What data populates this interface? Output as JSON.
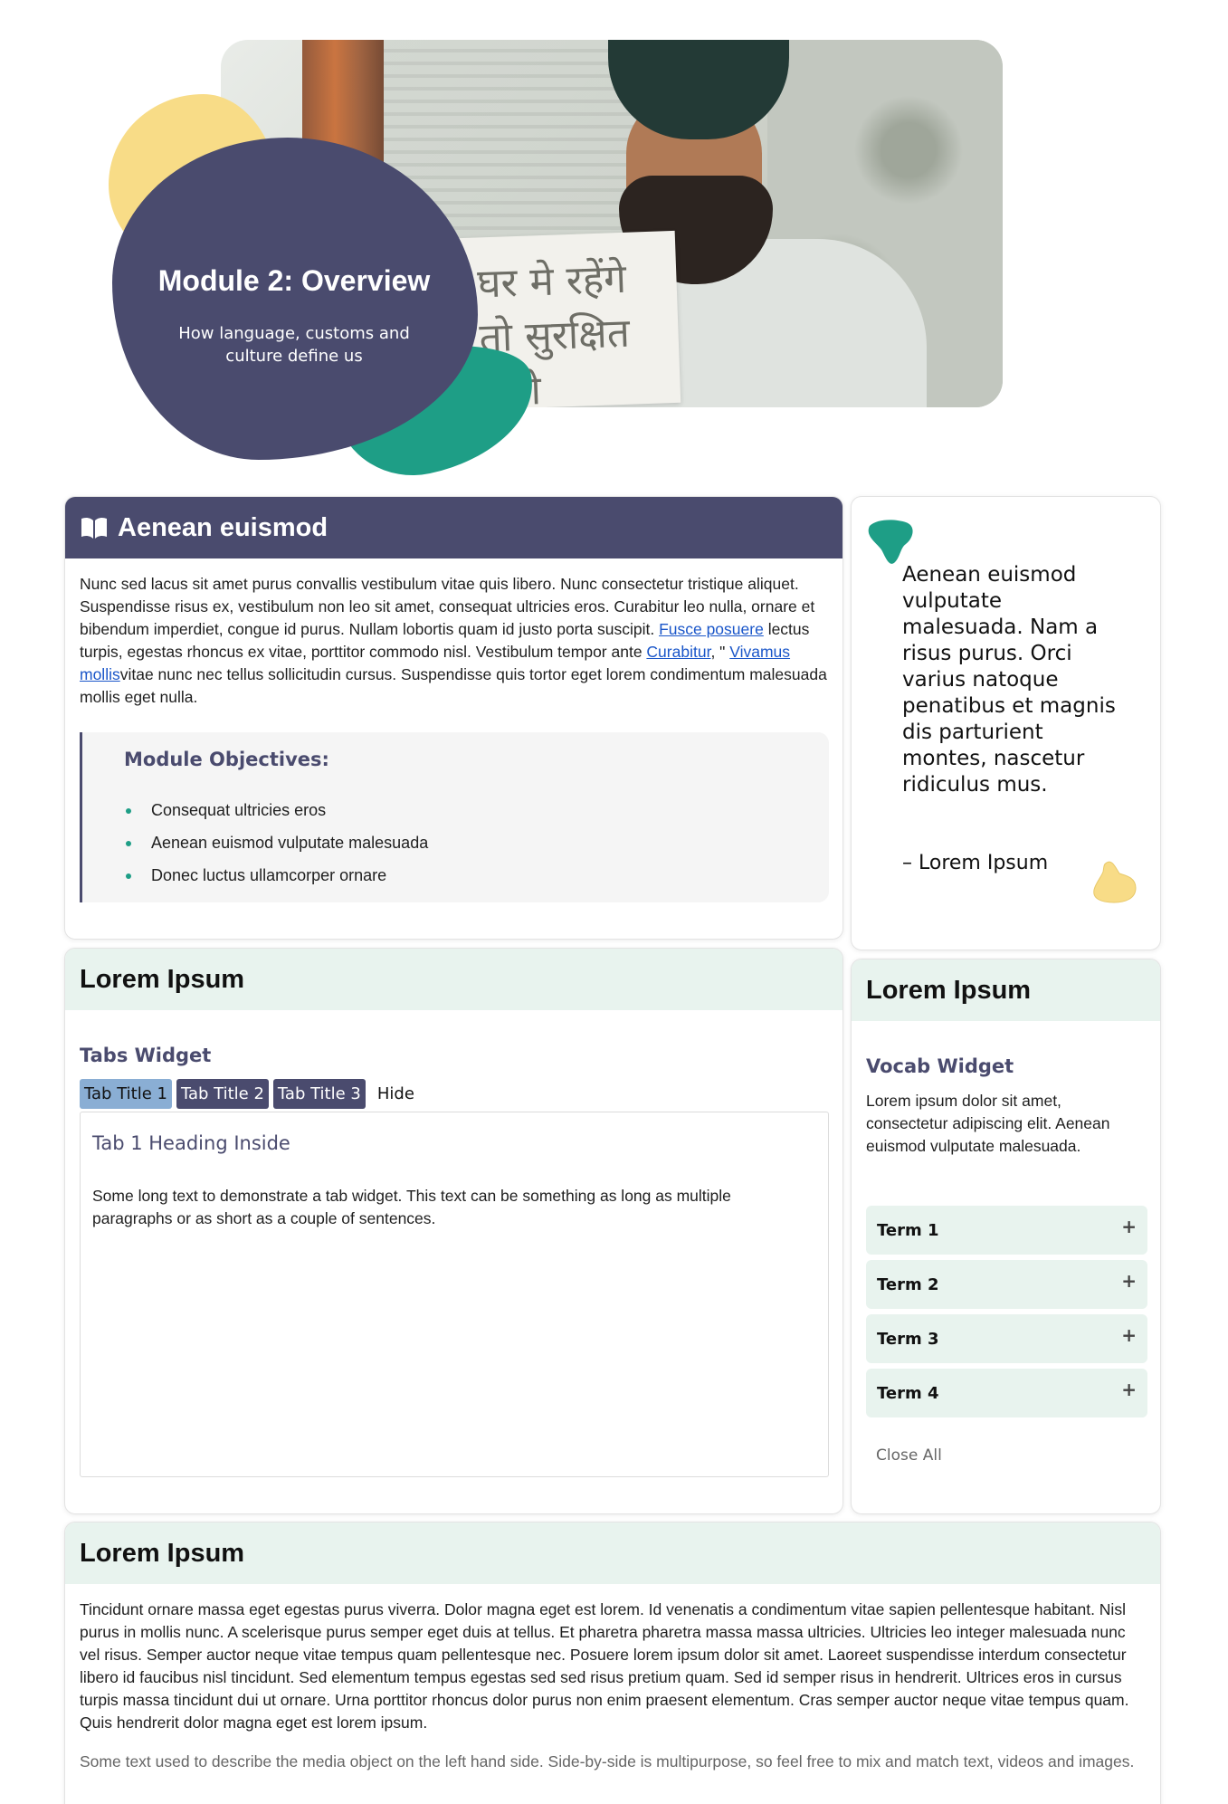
{
  "hero": {
    "title": "Module 2: Overview",
    "subtitle": "How language, customs and culture define us",
    "sign_text": "घर मे रहेंगे तो सुरक्षित रहेंगे",
    "colors": {
      "navy": "#4a4b6e",
      "yellow": "#f8dc87",
      "green": "#1e9e86"
    }
  },
  "intro_card": {
    "heading": "Aenean euismod",
    "icon": "book-open-icon",
    "para_1": "Nunc sed lacus sit amet purus convallis vestibulum vitae quis libero. Nunc consectetur tristique aliquet. Suspendisse risus ex, vestibulum non leo sit amet, consequat ultricies eros. Curabitur leo nulla, ornare et bibendum imperdiet, congue id purus. Nullam lobortis quam id justo porta suscipit. ",
    "link_1": "Fusce posuere",
    "para_2": " lectus turpis, egestas rhoncus ex vitae, porttitor commodo nisl. Vestibulum tempor ante ",
    "link_2": "Curabitur",
    "para_3": ", \" ",
    "link_3": "Vivamus mollis",
    "para_4": "vitae nunc nec tellus sollicitudin cursus. Suspendisse quis tortor eget lorem condimentum malesuada mollis eget nulla.",
    "objectives_title": "Module Objectives:",
    "objectives": [
      "Consequat ultricies eros",
      "Aenean euismod vulputate malesuada",
      "Donec luctus ullamcorper ornare"
    ]
  },
  "quote_card": {
    "text": "Aenean euismod vulputate malesuada. Nam a risus purus. Orci varius natoque penatibus et magnis dis parturient montes, nascetur ridiculus mus.",
    "author": "– Lorem Ipsum"
  },
  "tabs_card": {
    "heading": "Lorem Ipsum",
    "widget_title": "Tabs Widget",
    "tabs": [
      "Tab Title 1",
      "Tab Title 2",
      "Tab Title 3"
    ],
    "hide_label": "Hide",
    "panel_heading": "Tab 1 Heading Inside",
    "panel_body": "Some long text to demonstrate a tab widget. This text can be something as long as multiple paragraphs or as short as a couple of sentences."
  },
  "vocab_card": {
    "heading": "Lorem Ipsum",
    "widget_title": "Vocab Widget",
    "description": "Lorem ipsum dolor sit amet, consectetur adipiscing elit. Aenean euismod vulputate malesuada.",
    "terms": [
      "Term 1",
      "Term 2",
      "Term 3",
      "Term 4"
    ],
    "expand_symbol": "+",
    "close_all": "Close All"
  },
  "bottom_card": {
    "heading": "Lorem Ipsum",
    "para": "Tincidunt ornare massa eget egestas purus viverra. Dolor magna eget est lorem. Id venenatis a condimentum vitae sapien pellentesque habitant. Nisl purus in mollis nunc. A scelerisque purus semper eget duis at tellus. Et pharetra pharetra massa massa ultricies. Ultricies leo integer malesuada nunc vel risus. Semper auctor neque vitae tempus quam pellentesque nec. Posuere lorem ipsum dolor sit amet. Laoreet suspendisse interdum consectetur libero id faucibus nisl tincidunt. Sed elementum tempus egestas sed sed risus pretium quam. Sed id semper risus in hendrerit. Ultrices eros in cursus turpis massa tincidunt dui ut ornare. Urna porttitor rhoncus dolor purus non enim praesent elementum. Cras semper auctor neque vitae tempus quam. Quis hendrerit dolor magna eget est lorem ipsum.",
    "muted": "Some text used to describe the media object on the left hand side. Side-by-side is multipurpose, so feel free to mix and match text, videos and images."
  }
}
